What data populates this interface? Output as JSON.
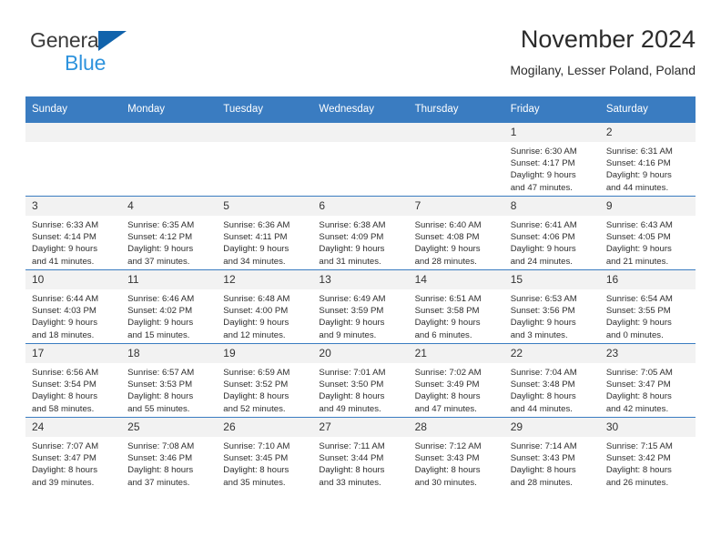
{
  "brand": {
    "name_top": "General",
    "name_bottom": "Blue",
    "triangle_color": "#1163ac",
    "blue_text_color": "#2e93dd"
  },
  "header": {
    "title": "November 2024",
    "subtitle": "Mogilany, Lesser Poland, Poland"
  },
  "theme": {
    "header_bar_color": "#3a7cc1",
    "daynum_band_color": "#f2f2f2",
    "grid_line_color": "#3a7cc1",
    "text_color": "#2e2e2e"
  },
  "weekdays": [
    "Sunday",
    "Monday",
    "Tuesday",
    "Wednesday",
    "Thursday",
    "Friday",
    "Saturday"
  ],
  "weeks": [
    [
      {
        "day": "",
        "sunrise": "",
        "sunset": "",
        "daylight1": "",
        "daylight2": ""
      },
      {
        "day": "",
        "sunrise": "",
        "sunset": "",
        "daylight1": "",
        "daylight2": ""
      },
      {
        "day": "",
        "sunrise": "",
        "sunset": "",
        "daylight1": "",
        "daylight2": ""
      },
      {
        "day": "",
        "sunrise": "",
        "sunset": "",
        "daylight1": "",
        "daylight2": ""
      },
      {
        "day": "",
        "sunrise": "",
        "sunset": "",
        "daylight1": "",
        "daylight2": ""
      },
      {
        "day": "1",
        "sunrise": "Sunrise: 6:30 AM",
        "sunset": "Sunset: 4:17 PM",
        "daylight1": "Daylight: 9 hours",
        "daylight2": "and 47 minutes."
      },
      {
        "day": "2",
        "sunrise": "Sunrise: 6:31 AM",
        "sunset": "Sunset: 4:16 PM",
        "daylight1": "Daylight: 9 hours",
        "daylight2": "and 44 minutes."
      }
    ],
    [
      {
        "day": "3",
        "sunrise": "Sunrise: 6:33 AM",
        "sunset": "Sunset: 4:14 PM",
        "daylight1": "Daylight: 9 hours",
        "daylight2": "and 41 minutes."
      },
      {
        "day": "4",
        "sunrise": "Sunrise: 6:35 AM",
        "sunset": "Sunset: 4:12 PM",
        "daylight1": "Daylight: 9 hours",
        "daylight2": "and 37 minutes."
      },
      {
        "day": "5",
        "sunrise": "Sunrise: 6:36 AM",
        "sunset": "Sunset: 4:11 PM",
        "daylight1": "Daylight: 9 hours",
        "daylight2": "and 34 minutes."
      },
      {
        "day": "6",
        "sunrise": "Sunrise: 6:38 AM",
        "sunset": "Sunset: 4:09 PM",
        "daylight1": "Daylight: 9 hours",
        "daylight2": "and 31 minutes."
      },
      {
        "day": "7",
        "sunrise": "Sunrise: 6:40 AM",
        "sunset": "Sunset: 4:08 PM",
        "daylight1": "Daylight: 9 hours",
        "daylight2": "and 28 minutes."
      },
      {
        "day": "8",
        "sunrise": "Sunrise: 6:41 AM",
        "sunset": "Sunset: 4:06 PM",
        "daylight1": "Daylight: 9 hours",
        "daylight2": "and 24 minutes."
      },
      {
        "day": "9",
        "sunrise": "Sunrise: 6:43 AM",
        "sunset": "Sunset: 4:05 PM",
        "daylight1": "Daylight: 9 hours",
        "daylight2": "and 21 minutes."
      }
    ],
    [
      {
        "day": "10",
        "sunrise": "Sunrise: 6:44 AM",
        "sunset": "Sunset: 4:03 PM",
        "daylight1": "Daylight: 9 hours",
        "daylight2": "and 18 minutes."
      },
      {
        "day": "11",
        "sunrise": "Sunrise: 6:46 AM",
        "sunset": "Sunset: 4:02 PM",
        "daylight1": "Daylight: 9 hours",
        "daylight2": "and 15 minutes."
      },
      {
        "day": "12",
        "sunrise": "Sunrise: 6:48 AM",
        "sunset": "Sunset: 4:00 PM",
        "daylight1": "Daylight: 9 hours",
        "daylight2": "and 12 minutes."
      },
      {
        "day": "13",
        "sunrise": "Sunrise: 6:49 AM",
        "sunset": "Sunset: 3:59 PM",
        "daylight1": "Daylight: 9 hours",
        "daylight2": "and 9 minutes."
      },
      {
        "day": "14",
        "sunrise": "Sunrise: 6:51 AM",
        "sunset": "Sunset: 3:58 PM",
        "daylight1": "Daylight: 9 hours",
        "daylight2": "and 6 minutes."
      },
      {
        "day": "15",
        "sunrise": "Sunrise: 6:53 AM",
        "sunset": "Sunset: 3:56 PM",
        "daylight1": "Daylight: 9 hours",
        "daylight2": "and 3 minutes."
      },
      {
        "day": "16",
        "sunrise": "Sunrise: 6:54 AM",
        "sunset": "Sunset: 3:55 PM",
        "daylight1": "Daylight: 9 hours",
        "daylight2": "and 0 minutes."
      }
    ],
    [
      {
        "day": "17",
        "sunrise": "Sunrise: 6:56 AM",
        "sunset": "Sunset: 3:54 PM",
        "daylight1": "Daylight: 8 hours",
        "daylight2": "and 58 minutes."
      },
      {
        "day": "18",
        "sunrise": "Sunrise: 6:57 AM",
        "sunset": "Sunset: 3:53 PM",
        "daylight1": "Daylight: 8 hours",
        "daylight2": "and 55 minutes."
      },
      {
        "day": "19",
        "sunrise": "Sunrise: 6:59 AM",
        "sunset": "Sunset: 3:52 PM",
        "daylight1": "Daylight: 8 hours",
        "daylight2": "and 52 minutes."
      },
      {
        "day": "20",
        "sunrise": "Sunrise: 7:01 AM",
        "sunset": "Sunset: 3:50 PM",
        "daylight1": "Daylight: 8 hours",
        "daylight2": "and 49 minutes."
      },
      {
        "day": "21",
        "sunrise": "Sunrise: 7:02 AM",
        "sunset": "Sunset: 3:49 PM",
        "daylight1": "Daylight: 8 hours",
        "daylight2": "and 47 minutes."
      },
      {
        "day": "22",
        "sunrise": "Sunrise: 7:04 AM",
        "sunset": "Sunset: 3:48 PM",
        "daylight1": "Daylight: 8 hours",
        "daylight2": "and 44 minutes."
      },
      {
        "day": "23",
        "sunrise": "Sunrise: 7:05 AM",
        "sunset": "Sunset: 3:47 PM",
        "daylight1": "Daylight: 8 hours",
        "daylight2": "and 42 minutes."
      }
    ],
    [
      {
        "day": "24",
        "sunrise": "Sunrise: 7:07 AM",
        "sunset": "Sunset: 3:47 PM",
        "daylight1": "Daylight: 8 hours",
        "daylight2": "and 39 minutes."
      },
      {
        "day": "25",
        "sunrise": "Sunrise: 7:08 AM",
        "sunset": "Sunset: 3:46 PM",
        "daylight1": "Daylight: 8 hours",
        "daylight2": "and 37 minutes."
      },
      {
        "day": "26",
        "sunrise": "Sunrise: 7:10 AM",
        "sunset": "Sunset: 3:45 PM",
        "daylight1": "Daylight: 8 hours",
        "daylight2": "and 35 minutes."
      },
      {
        "day": "27",
        "sunrise": "Sunrise: 7:11 AM",
        "sunset": "Sunset: 3:44 PM",
        "daylight1": "Daylight: 8 hours",
        "daylight2": "and 33 minutes."
      },
      {
        "day": "28",
        "sunrise": "Sunrise: 7:12 AM",
        "sunset": "Sunset: 3:43 PM",
        "daylight1": "Daylight: 8 hours",
        "daylight2": "and 30 minutes."
      },
      {
        "day": "29",
        "sunrise": "Sunrise: 7:14 AM",
        "sunset": "Sunset: 3:43 PM",
        "daylight1": "Daylight: 8 hours",
        "daylight2": "and 28 minutes."
      },
      {
        "day": "30",
        "sunrise": "Sunrise: 7:15 AM",
        "sunset": "Sunset: 3:42 PM",
        "daylight1": "Daylight: 8 hours",
        "daylight2": "and 26 minutes."
      }
    ]
  ]
}
